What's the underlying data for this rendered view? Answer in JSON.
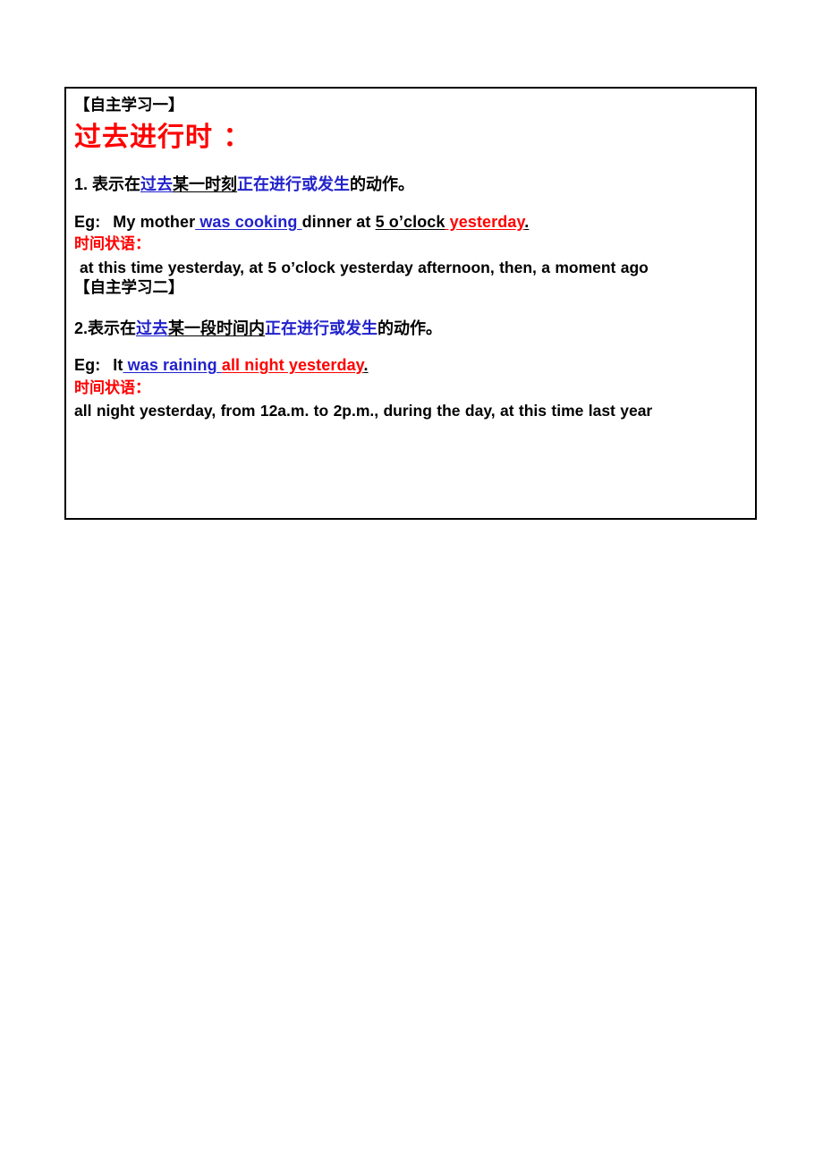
{
  "document": {
    "title": "过去进行时 ：",
    "title_color": "#FF0000"
  },
  "sections": [
    {
      "heading": "【自主学习一】",
      "rule": {
        "number": "1. ",
        "part_black_1": "表示在",
        "part_blue_underline": "过去",
        "part_black_underline": "某一时刻",
        "part_blue": "正在进行或发生",
        "part_black_2": "的动作。"
      },
      "example": {
        "label": "Eg:",
        "subject": "My mother",
        "verb_blue": " was cooking ",
        "middle": "dinner at ",
        "time_black": "5 o’clock",
        "time_red": " yesterday",
        "period": "."
      },
      "adverbial_label": "时间状语：",
      "adverbials": "at this time yesterday, at 5 o’clock yesterday afternoon, then, a moment ago"
    },
    {
      "heading": "【自主学习二】",
      "rule": {
        "number": "2.",
        "part_black_1": "表示在",
        "part_blue_underline": "过去",
        "part_black_underline": "某一段时间内",
        "part_blue": "正在进行或发生",
        "part_black_2": "的动作。"
      },
      "example": {
        "label": "Eg:",
        "subject": "It",
        "verb_blue": " was raining ",
        "gap": " ",
        "time_red": "all night yesterday",
        "period": "."
      },
      "adverbial_label": "时间状语：",
      "adverbials": "all night yesterday, from 12a.m. to 2p.m., during the day, at this time last year"
    }
  ],
  "colors": {
    "red": "#FF0000",
    "blue": "#2222CC",
    "black": "#000000",
    "border": "#000000"
  }
}
